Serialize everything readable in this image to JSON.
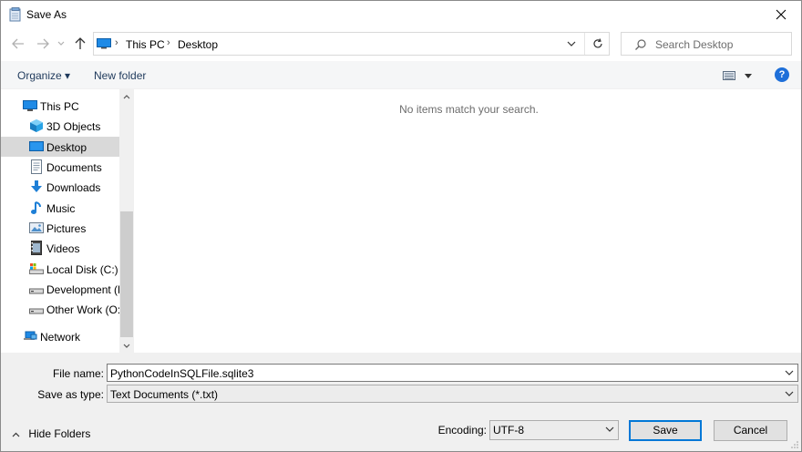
{
  "window": {
    "title": "Save As",
    "app_icon": "save-as-notepad-icon"
  },
  "address": {
    "crumbs": [
      "This PC",
      "Desktop"
    ],
    "separator": "›",
    "location_icon": "desktop-monitor-icon"
  },
  "search": {
    "placeholder": "Search Desktop"
  },
  "toolbar": {
    "organize_label": "Organize ▾",
    "new_folder_label": "New folder",
    "help_label": "?"
  },
  "nav": {
    "items": [
      {
        "label": "This PC",
        "icon": "this-pc-icon",
        "level": 0
      },
      {
        "label": "3D Objects",
        "icon": "3d-objects-icon",
        "level": 1
      },
      {
        "label": "Desktop",
        "icon": "desktop-icon",
        "level": 1,
        "selected": true
      },
      {
        "label": "Documents",
        "icon": "documents-icon",
        "level": 1
      },
      {
        "label": "Downloads",
        "icon": "downloads-icon",
        "level": 1
      },
      {
        "label": "Music",
        "icon": "music-icon",
        "level": 1
      },
      {
        "label": "Pictures",
        "icon": "pictures-icon",
        "level": 1
      },
      {
        "label": "Videos",
        "icon": "videos-icon",
        "level": 1
      },
      {
        "label": "Local Disk (C:)",
        "icon": "local-disk-icon",
        "level": 1
      },
      {
        "label": "Development (D",
        "icon": "drive-icon",
        "level": 1
      },
      {
        "label": "Other Work (O:)",
        "icon": "drive-icon",
        "level": 1
      },
      {
        "label": "Network",
        "icon": "network-icon",
        "level": 0
      }
    ]
  },
  "content": {
    "empty_message": "No items match your search."
  },
  "form": {
    "file_name_label": "File name:",
    "file_name_value": "PythonCodeInSQLFile.sqlite3",
    "save_type_label": "Save as type:",
    "save_type_value": "Text Documents (*.txt)",
    "encoding_label": "Encoding:",
    "encoding_value": "UTF-8"
  },
  "footer": {
    "hide_folders_label": "Hide Folders",
    "save_label": "Save",
    "cancel_label": "Cancel"
  },
  "colors": {
    "accent": "#0078d7",
    "selected_bg": "#d9d9d9",
    "link_text": "#1e395b"
  }
}
